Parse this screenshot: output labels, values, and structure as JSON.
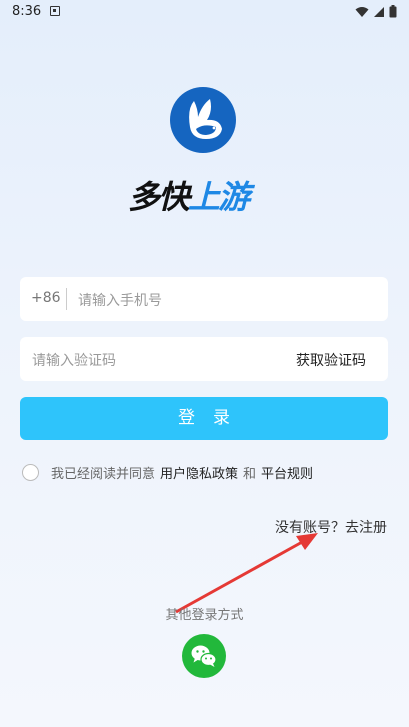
{
  "status_bar": {
    "time": "8:36",
    "icons": [
      "notification-icon",
      "wifi-icon",
      "signal-icon",
      "battery-icon"
    ]
  },
  "brand": {
    "name_part1": "多快",
    "name_part2": "上游",
    "primary_color": "#1565c0",
    "accent_color": "#1e88e5"
  },
  "phone": {
    "prefix": "+86",
    "placeholder": "请输入手机号"
  },
  "code": {
    "placeholder": "请输入验证码",
    "get_code_label": "获取验证码"
  },
  "login_button": {
    "label": "登录",
    "color": "#2ec4fb"
  },
  "agreement": {
    "prefix": "我已经阅读并同意",
    "privacy_link": "用户隐私政策",
    "and": "和",
    "rules_link": "平台规则",
    "checked": false
  },
  "register_link": "没有账号？去注册",
  "other_login": {
    "label": "其他登录方式",
    "methods": [
      "wechat-icon"
    ],
    "wechat_color": "#22b83b"
  },
  "annotation_arrow_color": "#e53935"
}
